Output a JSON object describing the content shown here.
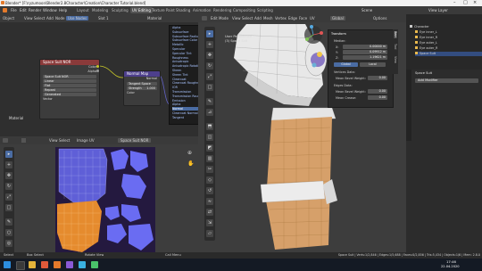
{
  "window": {
    "title": "Blender* [F:\\ryzumoon\\Blender2.8Character\\Creation\\Character Tutorial.blend]"
  },
  "menu": [
    "File",
    "Edit",
    "Render",
    "Window",
    "Help"
  ],
  "workspaces": [
    "Layout",
    "Modeling",
    "Sculpting",
    "UV Editing",
    "Texture Paint",
    "Shading",
    "Animation",
    "Rendering",
    "Compositing",
    "Scripting"
  ],
  "active_workspace": "UV Editing",
  "scene_label": "Scene",
  "view_layer_label": "View Layer",
  "node_editor": {
    "header": [
      "Object",
      "View",
      "Select",
      "Add",
      "Node",
      "Use Nodes"
    ],
    "slot": "Slot 1",
    "material": "Material",
    "image_node": {
      "title": "Space Suit NOR",
      "outputs": [
        "Color",
        "Alpha"
      ],
      "image_name": "Space Suit NOR",
      "interp": "Linear",
      "projection": "Flat",
      "extension": "Repeat",
      "colorspace": "Generated",
      "vector": "Vector"
    },
    "normal_node": {
      "title": "Normal Map",
      "output": "Normal",
      "space": "Tangent Space",
      "strength_label": "Strength",
      "strength_value": "1.000",
      "color_label": "Color"
    },
    "material_label": "Material",
    "dropdown_items": [
      "Alpha",
      "Subsurface",
      "Subsurface Radius",
      "Subsurface Color",
      "Metallic",
      "Specular",
      "Specular Tint",
      "Roughness",
      "Anisotropic",
      "Anisotropic Rotation",
      "Sheen",
      "Sheen Tint",
      "Clearcoat",
      "Clearcoat Roughness",
      "IOR",
      "Transmission",
      "Transmission Roughness",
      "Emission",
      "Alpha",
      "Normal",
      "Clearcoat Normal",
      "Tangent"
    ]
  },
  "uv_editor": {
    "header": [
      "View",
      "Select",
      "Image",
      "UV"
    ],
    "image_name": "Space Suit NOR"
  },
  "viewport": {
    "header": [
      "Edit Mode",
      "View",
      "Select",
      "Add",
      "Mesh",
      "Vertex",
      "Edge",
      "Face",
      "UV"
    ],
    "mode_info_1": "User Perspective",
    "mode_info_2": "(3) Space Suit",
    "orientation": "Global",
    "options_label": "Options",
    "npanel": {
      "header": "Transform",
      "median_label": "Median:",
      "x_label": "X:",
      "x_value": "0.00000 m",
      "y_label": "Y:",
      "y_value": "0.09912 m",
      "z_label": "Z:",
      "z_value": "1.19621 m",
      "global_label": "Global",
      "local_label": "Local",
      "vertices_data": "Vertices Data:",
      "mean_bevel_weight": "Mean Bevel Weight:",
      "mean_bevel_value": "0.00",
      "edges_data": "Edges Data:",
      "edge_bevel_weight": "Mean Bevel Weight:",
      "edge_bevel_value": "0.00",
      "mean_crease": "Mean Crease:",
      "mean_crease_value": "0.00"
    },
    "tabs": [
      "Item",
      "Tool",
      "View"
    ]
  },
  "outliner": {
    "rows": [
      {
        "name": "Character",
        "color": "#c8c8c8"
      },
      {
        "name": "Eye inner_L",
        "color": "#e9b94d"
      },
      {
        "name": "Eye inner_R",
        "color": "#e9b94d"
      },
      {
        "name": "Eye outer_L",
        "color": "#e9b94d"
      },
      {
        "name": "Eye outer_R",
        "color": "#e9b94d"
      },
      {
        "name": "Space Suit",
        "color": "#e9b94d"
      }
    ]
  },
  "properties": {
    "object_name": "Space Suit",
    "add_modifier": "Add Modifier"
  },
  "status": {
    "left_1": "Select",
    "left_2": "Box Select",
    "left_3": "Rotate View",
    "left_4": "Call Menu",
    "right": "Space Suit | Verts:1/2,846 | Edges:1/5,688 | Faces:0/2,856 | Tris:5,434 | Objects:1/6 | Mem: 2.8.0"
  },
  "taskbar": {
    "time": "17:46",
    "date": "22.04.2020"
  },
  "colors": {
    "accent": "#4a6ca3",
    "node_image_title": "#8a3a3a",
    "node_normal_title": "#4d3f8c",
    "uv_orange": "#e58b2e",
    "uv_blue": "#6a6cf2"
  }
}
